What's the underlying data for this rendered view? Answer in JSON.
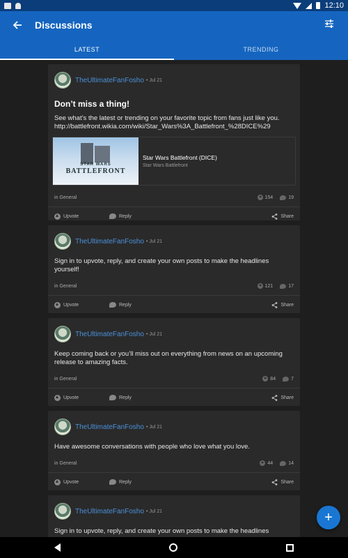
{
  "status_bar": {
    "time": "12:10"
  },
  "app_bar": {
    "title": "Discussions"
  },
  "tabs": [
    {
      "label": "LATEST",
      "active": true
    },
    {
      "label": "TRENDING",
      "active": false
    }
  ],
  "posts": [
    {
      "author": "TheUltimateFanFosho",
      "date": "• Jul 21",
      "title": "Don’t miss a thing!",
      "body": "See what’s the latest or trending on your favorite topic from fans just like you. http://battlefront.wikia.com/wiki/Star_Wars%3A_Battlefront_%28DICE%29",
      "link_preview": {
        "image_line1": "STAR WARS",
        "image_line2": "BATTLEFRONT",
        "title": "Star Wars Battlefront (DICE)",
        "subtitle": "Star Wars Battlefront"
      },
      "category": "in General",
      "upvotes": "154",
      "replies": "19"
    },
    {
      "author": "TheUltimateFanFosho",
      "date": "• Jul 21",
      "body": "Sign in to upvote, reply, and create your own posts to make the headlines yourself!",
      "category": "in General",
      "upvotes": "121",
      "replies": "17"
    },
    {
      "author": "TheUltimateFanFosho",
      "date": "• Jul 21",
      "body": "Keep coming back or you’ll miss out on everything from news on an upcoming release to amazing facts.",
      "category": "in General",
      "upvotes": "84",
      "replies": "7"
    },
    {
      "author": "TheUltimateFanFosho",
      "date": "• Jul 21",
      "body": "Have awesome conversations with people who love what you love.",
      "category": "in General",
      "upvotes": "44",
      "replies": "14"
    },
    {
      "author": "TheUltimateFanFosho",
      "date": "• Jul 21",
      "body": "Sign in to upvote, reply, and create your own posts to make the headlines"
    }
  ],
  "actions": {
    "upvote": "Upvote",
    "reply": "Reply",
    "share": "Share"
  },
  "fab": {
    "icon": "+"
  },
  "icons": {
    "back": "arrow-left-icon",
    "filter": "sliders-icon",
    "fab": "plus-icon"
  },
  "colors": {
    "app_bar": "#1565c0",
    "status_bar": "#0b3d7a",
    "author": "#4a90d9",
    "card": "#2a2a2a",
    "background": "#1e1e1e"
  }
}
